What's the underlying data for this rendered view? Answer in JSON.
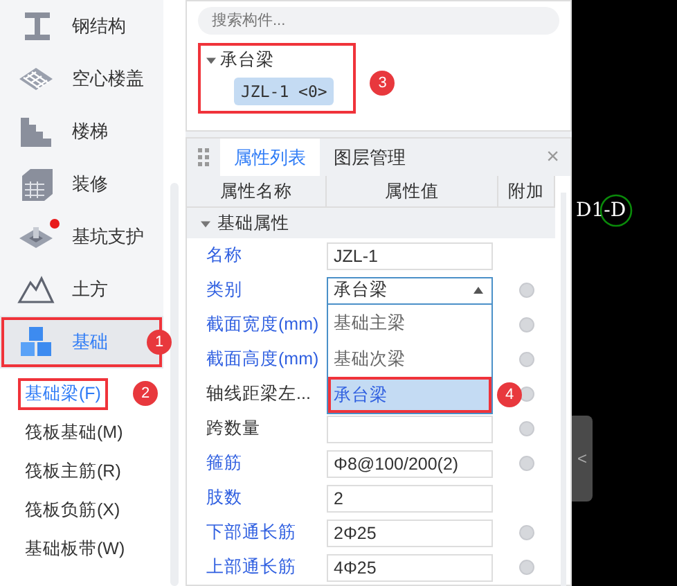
{
  "search": {
    "placeholder": "搜索构件..."
  },
  "sidebar": {
    "items": [
      {
        "label": "钢结构",
        "selected": false,
        "notification": false
      },
      {
        "label": "空心楼盖",
        "selected": false,
        "notification": false
      },
      {
        "label": "楼梯",
        "selected": false,
        "notification": false
      },
      {
        "label": "装修",
        "selected": false,
        "notification": false
      },
      {
        "label": "基坑支护",
        "selected": false,
        "notification": true
      },
      {
        "label": "土方",
        "selected": false,
        "notification": false
      },
      {
        "label": "基础",
        "selected": true,
        "notification": false,
        "annotation": "1"
      }
    ],
    "sub_items": [
      {
        "label": "基础梁(F)",
        "selected": true,
        "annotation": "2"
      },
      {
        "label": "筏板基础(M)",
        "selected": false
      },
      {
        "label": "筏板主筋(R)",
        "selected": false
      },
      {
        "label": "筏板负筋(X)",
        "selected": false
      },
      {
        "label": "基础板带(W)",
        "selected": false
      }
    ]
  },
  "tree": {
    "annotation": "3",
    "groups": [
      {
        "label": "承台梁",
        "expanded": true,
        "children": [
          {
            "label": "JZL-1 <0>",
            "selected": true
          }
        ]
      }
    ]
  },
  "properties": {
    "tabs": [
      {
        "label": "属性列表",
        "selected": true
      },
      {
        "label": "图层管理",
        "selected": false
      }
    ],
    "close": "×",
    "columns": [
      "属性名称",
      "属性值",
      "附加"
    ],
    "section": {
      "label": "基础属性",
      "expanded": true
    },
    "rows": [
      {
        "name": "名称",
        "linked": true,
        "kind": "text",
        "value": "JZL-1",
        "attach": false
      },
      {
        "name": "类别",
        "linked": true,
        "kind": "select",
        "value": "承台梁",
        "attach": true,
        "open": true,
        "options": [
          {
            "label": "基础主梁",
            "selected": false
          },
          {
            "label": "基础次梁",
            "selected": false
          },
          {
            "label": "承台梁",
            "selected": true,
            "annotation": "4"
          }
        ]
      },
      {
        "name": "截面宽度(mm)",
        "linked": true,
        "kind": "covered",
        "attach": true
      },
      {
        "name": "截面高度(mm)",
        "linked": true,
        "kind": "covered",
        "attach": true
      },
      {
        "name": "轴线距梁左...",
        "linked": false,
        "kind": "covered",
        "attach": true
      },
      {
        "name": "跨数量",
        "linked": false,
        "kind": "text",
        "value": "",
        "attach": true
      },
      {
        "name": "箍筋",
        "linked": true,
        "kind": "text",
        "value": "Φ8@100/200(2)",
        "attach": true
      },
      {
        "name": "肢数",
        "linked": true,
        "kind": "text",
        "value": "2",
        "attach": false
      },
      {
        "name": "下部通长筋",
        "linked": true,
        "kind": "text",
        "value": "2Φ25",
        "attach": true
      },
      {
        "name": "上部通长筋",
        "linked": true,
        "kind": "text",
        "value": "4Φ25",
        "attach": true
      }
    ]
  },
  "canvas": {
    "label": "D1-D",
    "collapse": "<"
  }
}
